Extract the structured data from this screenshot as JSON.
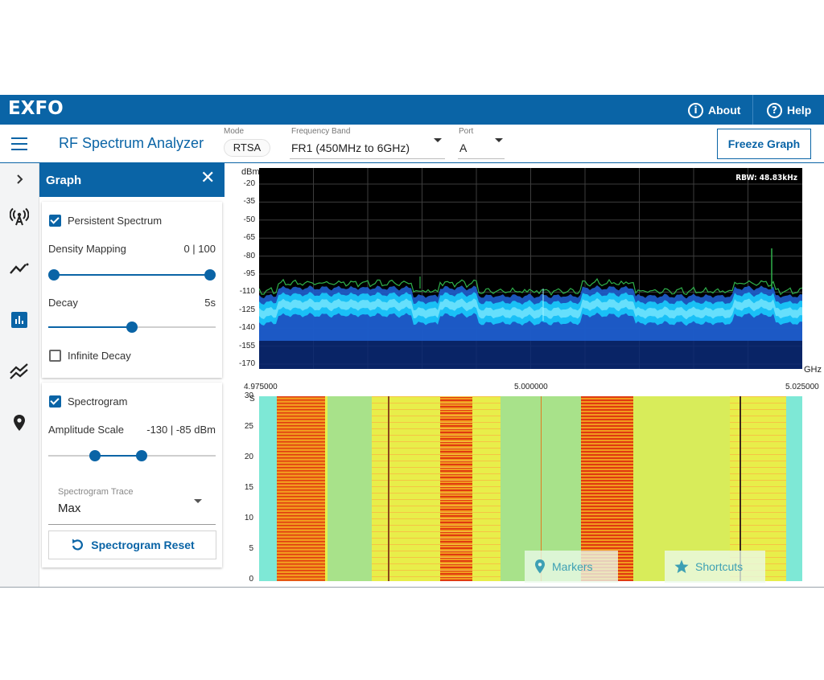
{
  "app": {
    "logo": "EXFO",
    "about_label": "About",
    "help_label": "Help",
    "title": "RF Spectrum Analyzer"
  },
  "header": {
    "mode": {
      "label": "Mode",
      "value": "RTSA"
    },
    "band": {
      "label": "Frequency Band",
      "value": "FR1 (450MHz to 6GHz)"
    },
    "port": {
      "label": "Port",
      "value": "A"
    },
    "freeze_label": "Freeze Graph"
  },
  "rail": {
    "items": [
      "chevron-right-icon",
      "antenna-icon",
      "trend-line-icon",
      "bar-chart-icon",
      "double-trend-icon",
      "location-pin-icon"
    ],
    "active": "bar-chart-icon"
  },
  "panel": {
    "title": "Graph",
    "persistent": {
      "label": "Persistent Spectrum",
      "checked": true,
      "density_label": "Density Mapping",
      "density_value": "0 | 100",
      "density_range": [
        0,
        100
      ],
      "decay_label": "Decay",
      "decay_value": "5s",
      "decay_fraction": 0.5,
      "infinite_label": "Infinite Decay",
      "infinite_checked": false
    },
    "spectrogram": {
      "label": "Spectrogram",
      "checked": true,
      "amp_label": "Amplitude Scale",
      "amp_value": "-130 | -85 dBm",
      "amp_fractions": [
        0.28,
        0.56
      ],
      "trace_label": "Spectrogram Trace",
      "trace_value": "Max",
      "reset_label": "Spectrogram Reset"
    }
  },
  "spectrum": {
    "unit": "dBm",
    "rbw": "RBW: 48.83kHz",
    "y_ticks": [
      "-20",
      "-35",
      "-50",
      "-65",
      "-80",
      "-95",
      "-110",
      "-125",
      "-140",
      "-155",
      "-170"
    ],
    "x_unit": "GHz",
    "x_ticks": [
      "4.975000",
      "5.000000",
      "5.025000"
    ]
  },
  "spectrogram_view": {
    "unit": "S",
    "y_ticks": [
      "30",
      "25",
      "20",
      "15",
      "10",
      "5",
      "0"
    ],
    "markers_label": "Markers",
    "shortcuts_label": "Shortcuts"
  },
  "colors": {
    "brand": "#0a64a6",
    "trace_cyan": "#19d2ff",
    "trace_green": "#2fb04a",
    "heat_red": "#e03a10",
    "heat_orange": "#f29a1e",
    "heat_yellow": "#e8ee4a",
    "heat_green": "#a8e28a",
    "heat_cyan": "#7ee8d6"
  }
}
